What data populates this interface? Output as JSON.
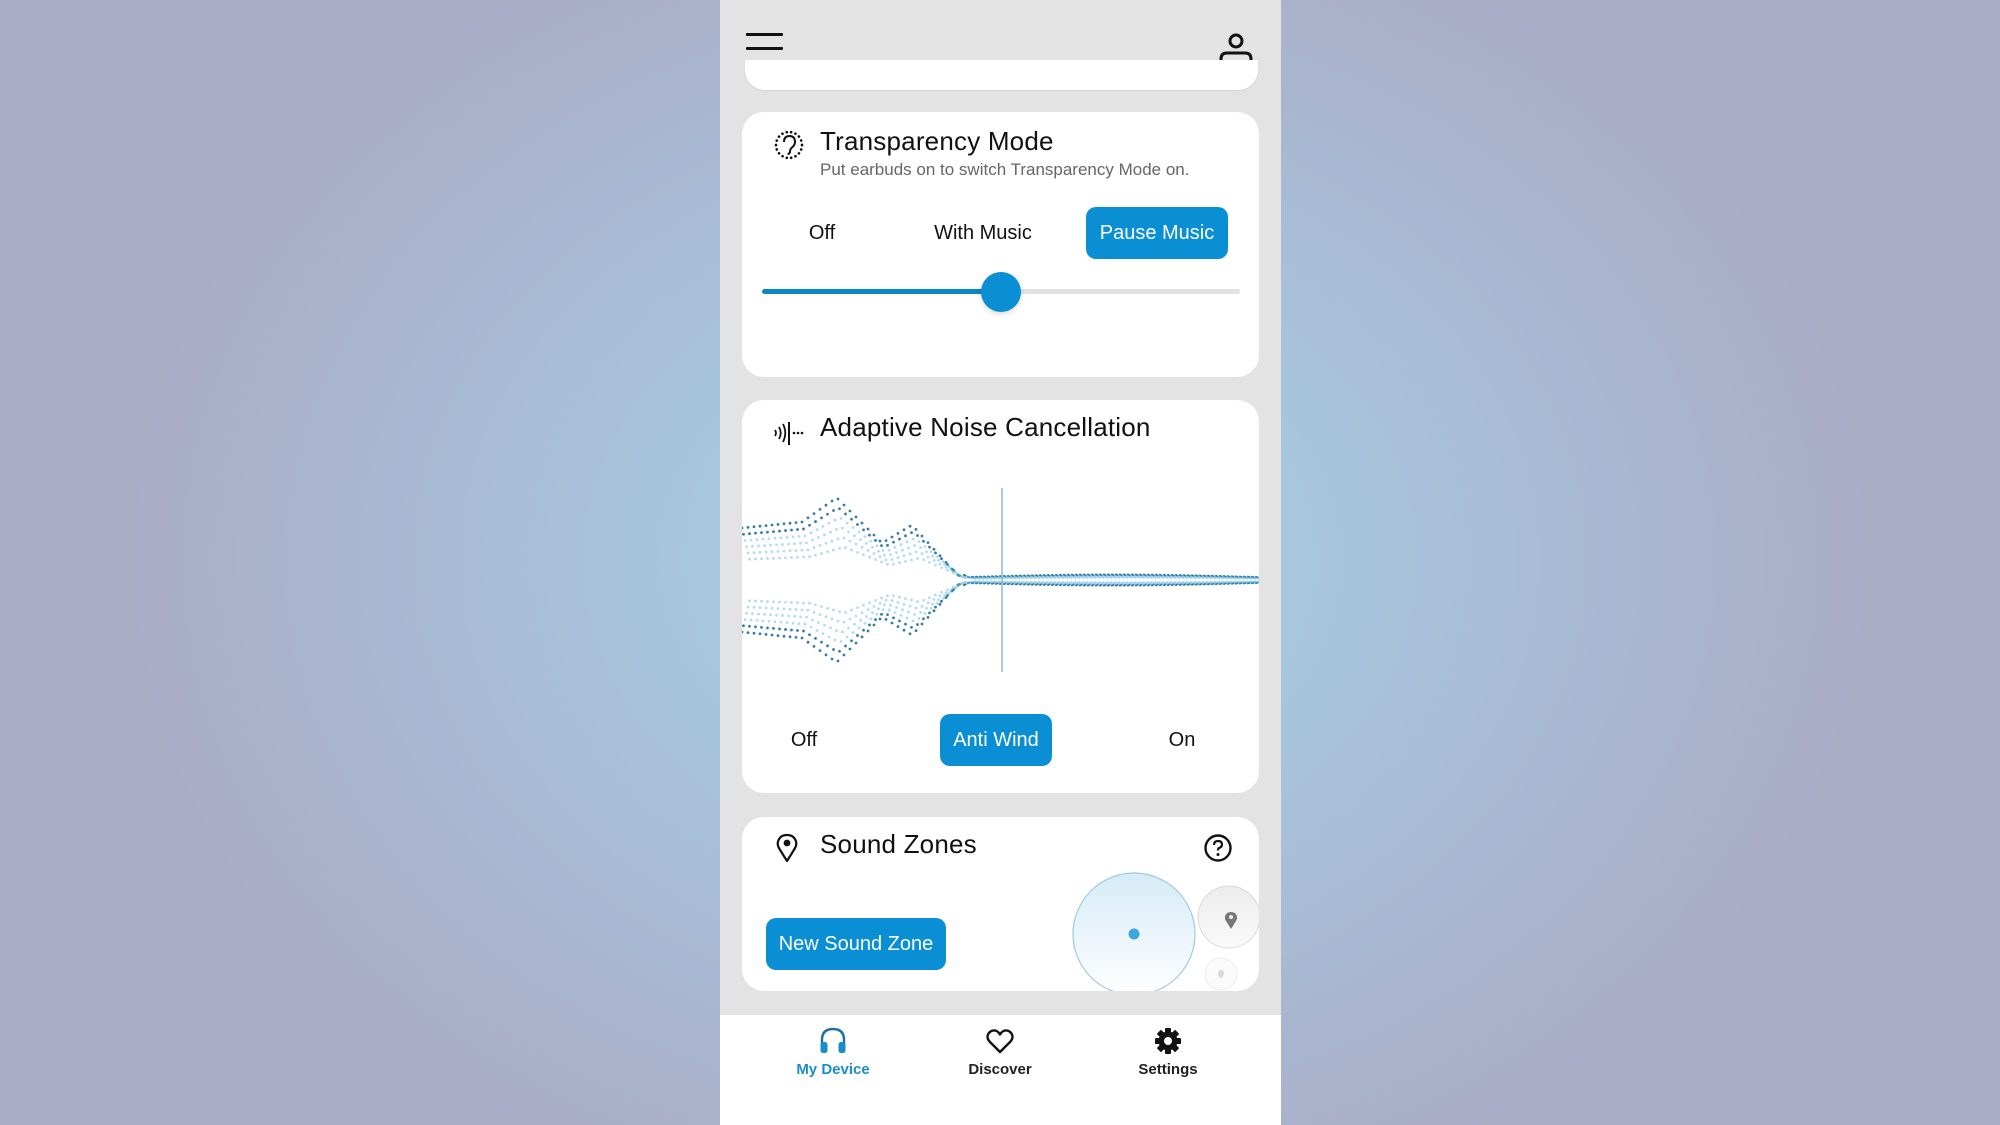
{
  "theme": {
    "accent": "#0a8fd4",
    "panel_bg": "#e3e3e3",
    "card_bg": "#ffffff",
    "active_nav": "#1a8ec9"
  },
  "header": {
    "menu_icon": "hamburger-menu-icon",
    "profile_icon": "user-profile-icon"
  },
  "transparency": {
    "icon": "ear-icon",
    "title": "Transparency Mode",
    "subtitle": "Put earbuds on to switch Transparency Mode on.",
    "options": [
      {
        "label": "Off",
        "active": false
      },
      {
        "label": "With Music",
        "active": false
      },
      {
        "label": "Pause Music",
        "active": true
      }
    ],
    "slider_value": 0.5
  },
  "anc": {
    "icon": "noise-cancellation-icon",
    "title": "Adaptive Noise Cancellation",
    "visual": "sound-wave-visualization",
    "options": [
      {
        "label": "Off",
        "active": false
      },
      {
        "label": "Anti Wind",
        "active": true
      },
      {
        "label": "On",
        "active": false
      }
    ]
  },
  "sound_zones": {
    "icon": "location-pin-icon",
    "title": "Sound Zones",
    "help_icon": "help-question-icon",
    "new_button": "New Sound Zone",
    "map_visual": "sound-zone-map"
  },
  "bottom_nav": {
    "items": [
      {
        "label": "My Device",
        "icon": "headphones-icon",
        "active": true
      },
      {
        "label": "Discover",
        "icon": "heart-icon",
        "active": false
      },
      {
        "label": "Settings",
        "icon": "gear-icon",
        "active": false
      }
    ]
  }
}
